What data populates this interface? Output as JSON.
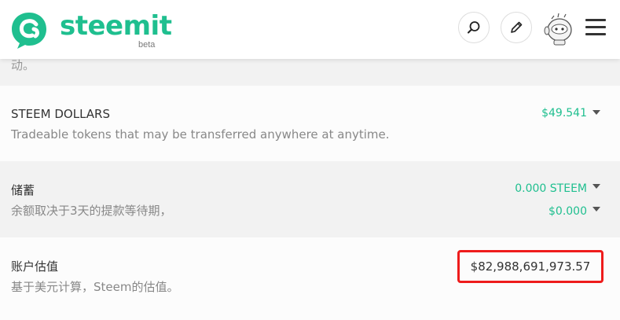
{
  "header": {
    "brand": "steemit",
    "beta_label": "beta",
    "icons": {
      "logo": "steemit-logo",
      "search": "search-icon",
      "post": "pencil-icon",
      "avatar": "user-avatar",
      "menu": "hamburger-menu-icon"
    },
    "accent_color": "#1fbf8f"
  },
  "partial_row": {
    "text": "动。"
  },
  "rows": [
    {
      "title": "STEEM DOLLARS",
      "description": "Tradeable tokens that may be transferred anywhere at anytime.",
      "values": [
        "$49.541"
      ]
    },
    {
      "title": "储蓄",
      "description": "余额取决于3天的提款等待期，",
      "values": [
        "0.000 STEEM",
        "$0.000"
      ]
    },
    {
      "title": "账户估值",
      "description": "基于美元计算，Steem的估值。",
      "values": [
        "$82,988,691,973.57"
      ]
    }
  ],
  "highlight_color": "#ee1c1c"
}
